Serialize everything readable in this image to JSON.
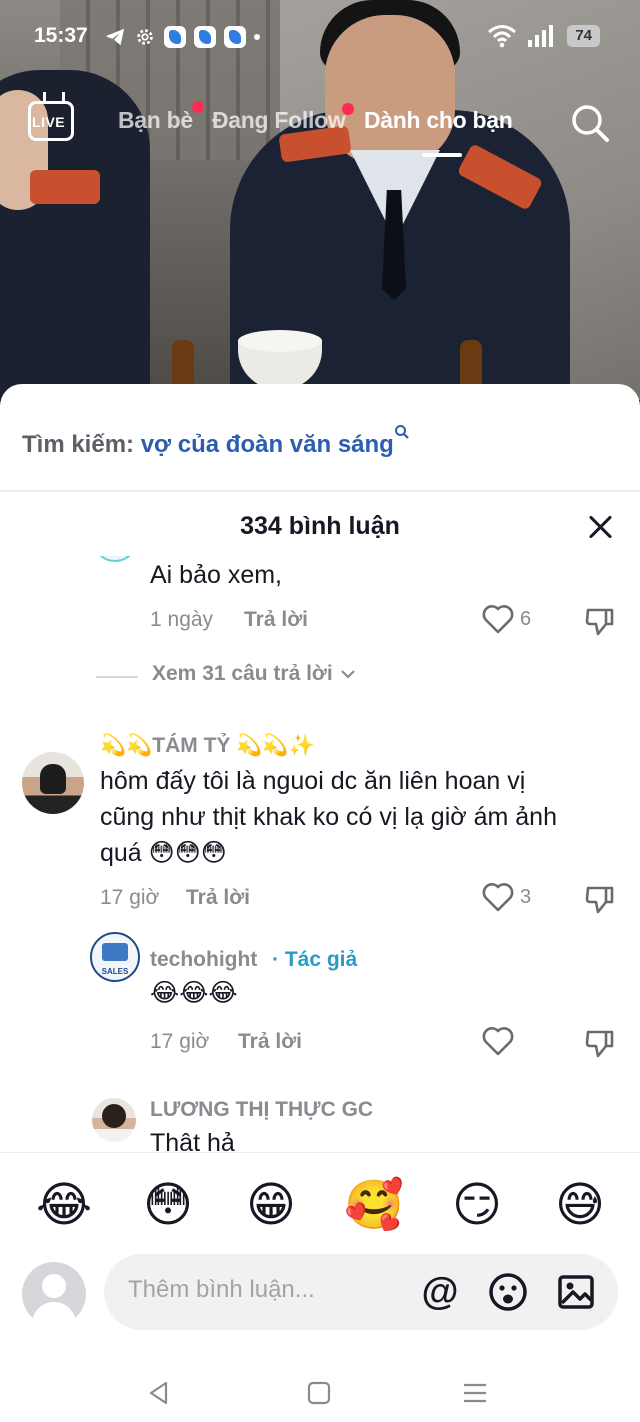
{
  "status_bar": {
    "time": "15:37",
    "battery": "74"
  },
  "top_nav": {
    "live_label": "LIVE",
    "tabs": [
      {
        "label": "Bạn bè"
      },
      {
        "label": "Đang Follow"
      },
      {
        "label": "Dành cho bạn"
      }
    ]
  },
  "sheet": {
    "search_prefix": "Tìm kiếm:",
    "search_query": "vợ của đoàn văn sáng",
    "comment_count_title": "334 bình luận",
    "comments": [
      {
        "text": "Ai bảo xem,",
        "time": "1 ngày",
        "reply_label": "Trả lời",
        "likes": "6",
        "view_replies": "Xem 31 câu trả lời"
      },
      {
        "name": "💫💫TÁM TỶ 💫💫✨",
        "line1": "hôm đấy tôi là nguoi dc ăn liên hoan vị",
        "line2": "cũng như thịt khak ko có vị lạ giờ ám ảnh",
        "line3": "quá 😳😳😳",
        "time": "17 giờ",
        "reply_label": "Trả lời",
        "likes": "3"
      },
      {
        "name": "techohight",
        "author_tag": "· Tác giả",
        "text": "😂😂😂",
        "time": "17 giờ",
        "reply_label": "Trả lời",
        "avatar_text": "SALES"
      },
      {
        "name": "LƯƠNG THỊ THỰC GC",
        "text": "Thật hả"
      }
    ],
    "emojis": [
      "😂",
      "😳",
      "😁",
      "🥰",
      "😏",
      "😅"
    ],
    "input_placeholder": "Thêm bình luận...",
    "mention_icon": "@"
  }
}
